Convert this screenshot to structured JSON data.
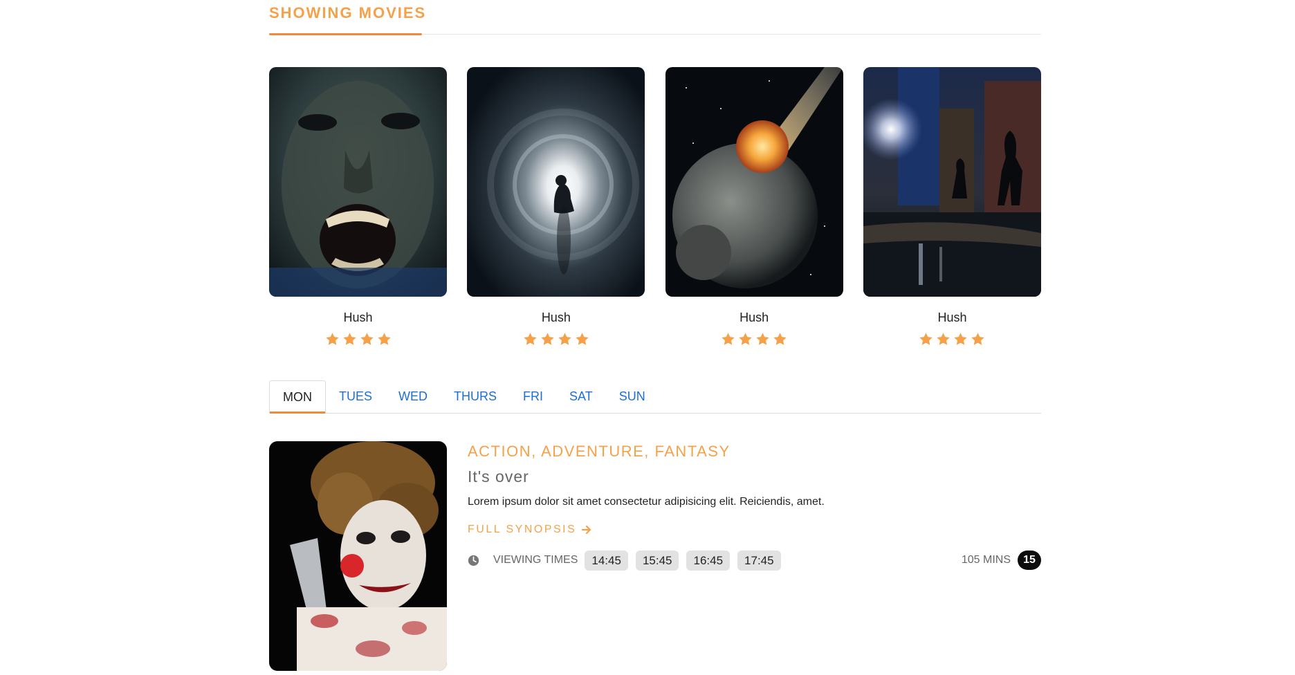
{
  "section": {
    "title": "SHOWING MOVIES"
  },
  "movies": [
    {
      "title": "Hush",
      "rating": 4
    },
    {
      "title": "Hush",
      "rating": 4
    },
    {
      "title": "Hush",
      "rating": 4
    },
    {
      "title": "Hush",
      "rating": 4
    }
  ],
  "tabs": [
    "MON",
    "TUES",
    "WED",
    "THURS",
    "FRI",
    "SAT",
    "SUN"
  ],
  "active_tab": "MON",
  "featured": {
    "genres": "ACTION, ADVENTURE, FANTASY",
    "tagline": "It's over",
    "description": "Lorem ipsum dolor sit amet consectetur adipisicing elit. Reiciendis, amet.",
    "synopsis_label": "FULL SYNOPSIS",
    "viewing_label": "VIEWING TIMES",
    "times": [
      "14:45",
      "15:45",
      "16:45",
      "17:45"
    ],
    "duration": "105 MINS",
    "age_rating": "15"
  },
  "colors": {
    "accent": "#f5a14a",
    "accent_dark": "#f08a3c",
    "tab_link": "#1a6fd6",
    "star": "#f5a14a"
  },
  "icons": {
    "star": "star-icon",
    "arrow": "arrow-right-icon",
    "clock": "clock-icon"
  }
}
